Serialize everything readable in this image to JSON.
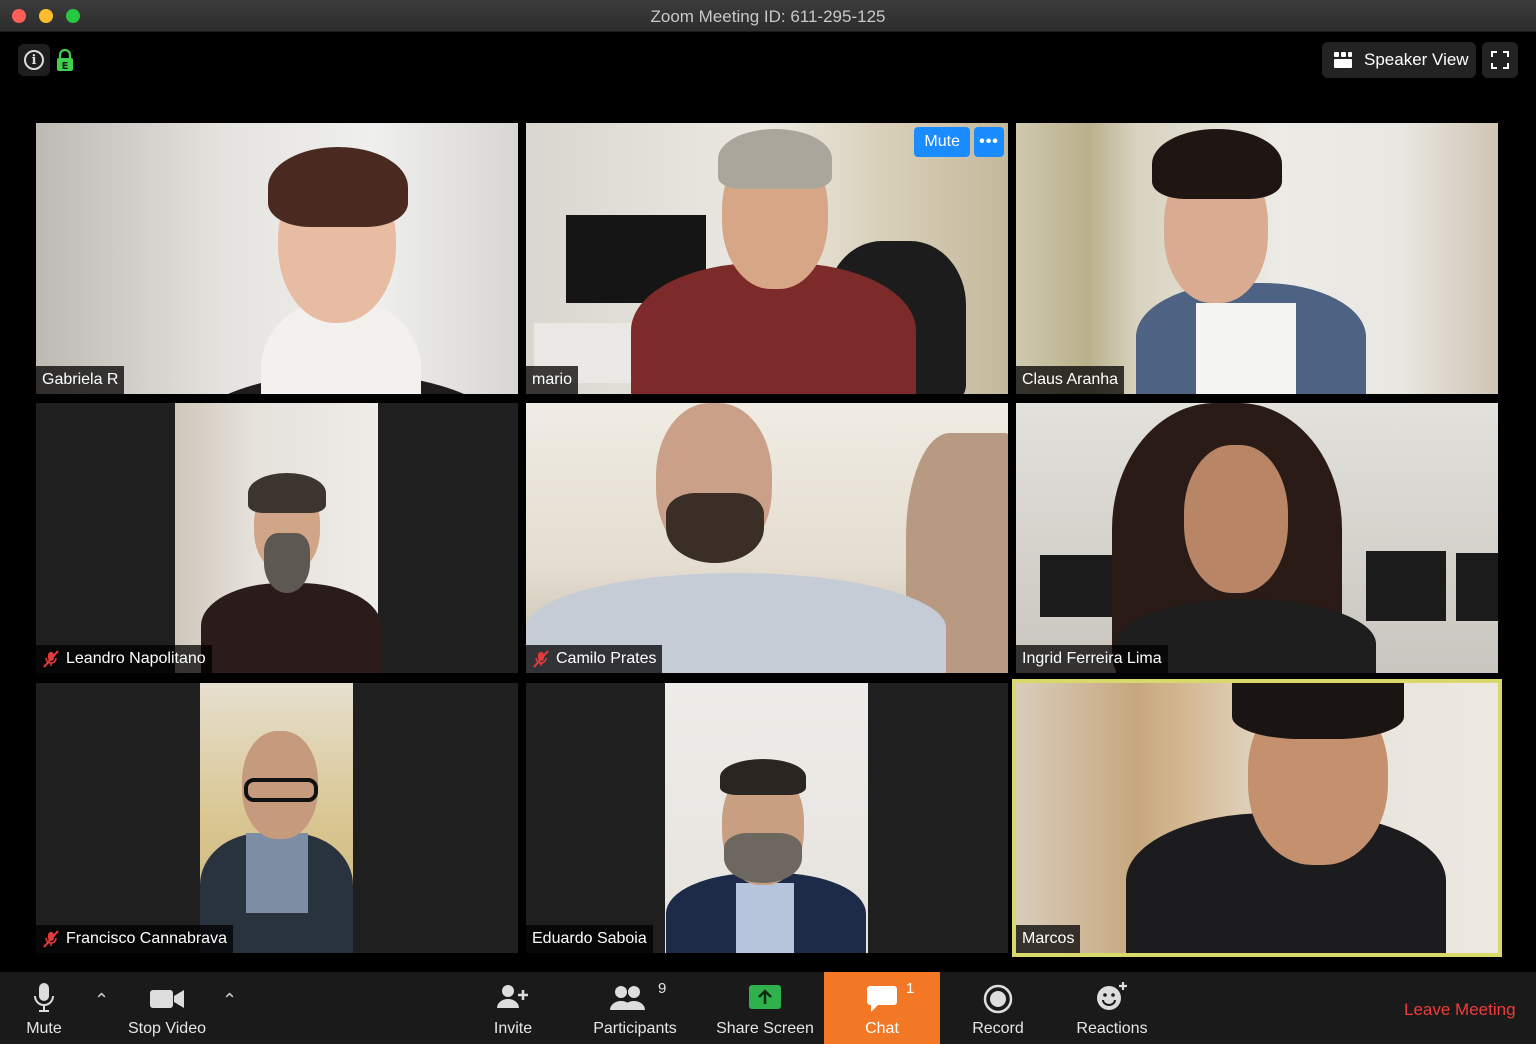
{
  "window": {
    "title": "Zoom Meeting ID: 611-295-125"
  },
  "top_controls": {
    "speaker_view_label": "Speaker View"
  },
  "participants": [
    {
      "name": "Gabriela R",
      "muted": false,
      "active": false
    },
    {
      "name": "mario",
      "muted": false,
      "active": false,
      "hover_mute_label": "Mute",
      "hover_more_label": "•••"
    },
    {
      "name": "Claus Aranha",
      "muted": false,
      "active": false
    },
    {
      "name": "Leandro Napolitano",
      "muted": true,
      "active": false
    },
    {
      "name": "Camilo Prates",
      "muted": true,
      "active": false
    },
    {
      "name": "Ingrid Ferreira Lima",
      "muted": false,
      "active": false
    },
    {
      "name": "Francisco Cannabrava",
      "muted": true,
      "active": false
    },
    {
      "name": "Eduardo Saboia",
      "muted": false,
      "active": false
    },
    {
      "name": "Marcos",
      "muted": false,
      "active": true
    }
  ],
  "toolbar": {
    "mute_label": "Mute",
    "stop_video_label": "Stop Video",
    "invite_label": "Invite",
    "participants_label": "Participants",
    "participants_count": "9",
    "share_screen_label": "Share Screen",
    "chat_label": "Chat",
    "chat_count": "1",
    "record_label": "Record",
    "reactions_label": "Reactions",
    "leave_label": "Leave Meeting"
  },
  "colors": {
    "accent_blue": "#1a8cff",
    "chat_orange": "#f27825",
    "leave_red": "#ef3b3b",
    "active_speaker_border": "#d9d86a",
    "share_green": "#2fb24c"
  },
  "icons": [
    "info-icon",
    "encryption-lock-icon",
    "grid-icon",
    "fullscreen-icon",
    "microphone-icon",
    "video-camera-icon",
    "add-person-icon",
    "participants-icon",
    "share-screen-icon",
    "chat-bubble-icon",
    "record-icon",
    "reactions-icon",
    "muted-mic-icon"
  ]
}
